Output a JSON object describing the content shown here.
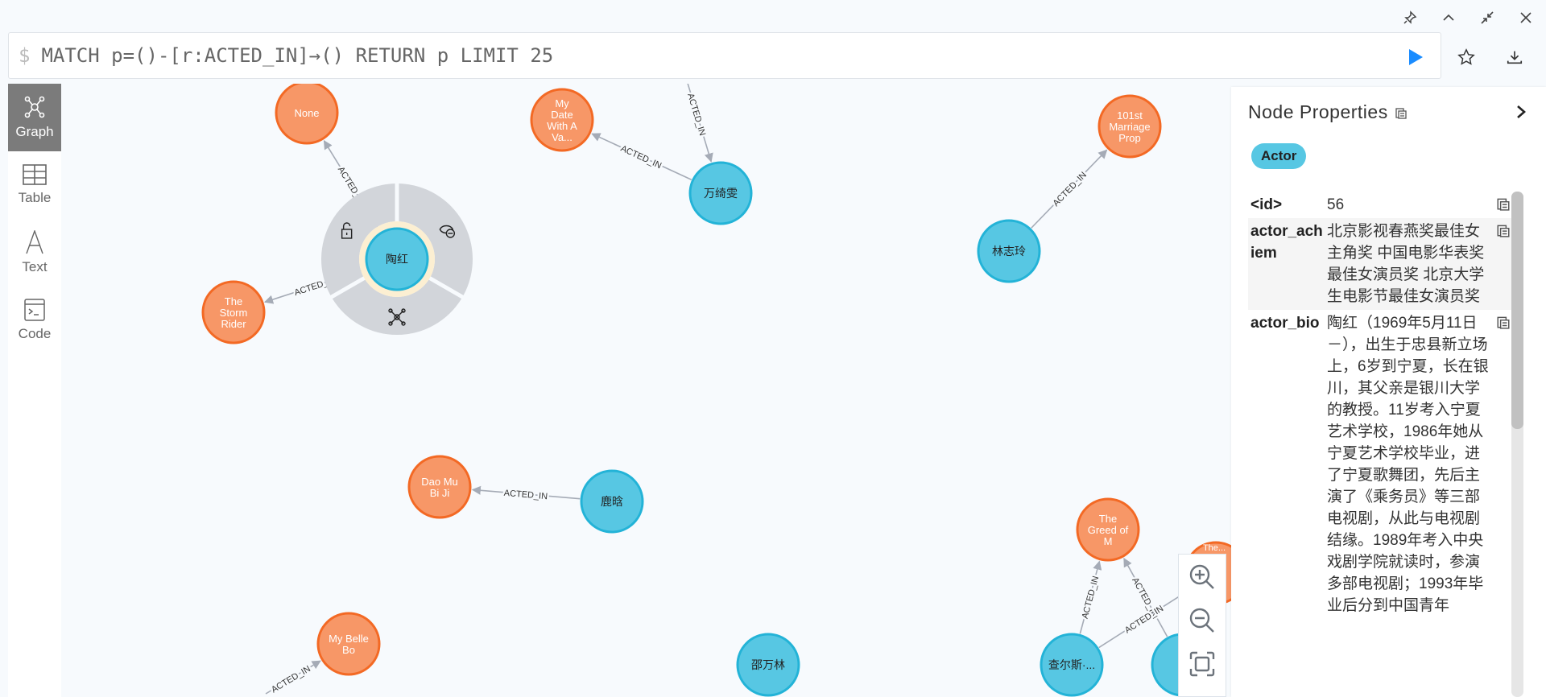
{
  "window_controls": {
    "pin": "pin-icon",
    "collapse": "chevron-up-icon",
    "minimize": "shrink-icon",
    "close": "close-icon"
  },
  "query": {
    "prompt": "$",
    "text": "MATCH p=()-[r:ACTED_IN]→() RETURN p LIMIT 25"
  },
  "sidebar": {
    "items": [
      {
        "label": "Graph",
        "icon": "graph-icon",
        "active": true
      },
      {
        "label": "Table",
        "icon": "table-icon"
      },
      {
        "label": "Text",
        "icon": "text-icon"
      },
      {
        "label": "Code",
        "icon": "code-icon"
      }
    ]
  },
  "colors": {
    "actor": "#57c7e3",
    "actor_border": "#23b3d7",
    "movie": "#f79767",
    "movie_border": "#f36924",
    "edge": "#a5abb6",
    "run": "#1a8cff",
    "ring": "#d2d5da",
    "halo": "#fcefd2"
  },
  "graph": {
    "nodes": [
      {
        "id": "n0",
        "label": "None",
        "type": "Movie"
      },
      {
        "id": "n1",
        "label": "My Date With A Va...",
        "type": "Movie",
        "lines": [
          "My",
          "Date",
          "With A",
          "Va..."
        ]
      },
      {
        "id": "n2",
        "label": "万绮雯",
        "type": "Actor"
      },
      {
        "id": "n3",
        "label": "101st Marriage Prop",
        "type": "Movie",
        "lines": [
          "101st",
          "Marriage",
          "Prop"
        ]
      },
      {
        "id": "n4",
        "label": "林志玲",
        "type": "Actor"
      },
      {
        "id": "n5",
        "label": "陶红",
        "type": "Actor",
        "selected": true
      },
      {
        "id": "n6",
        "label": "The Storm Rider",
        "type": "Movie",
        "lines": [
          "The",
          "Storm",
          "Rider"
        ]
      },
      {
        "id": "n7",
        "label": "Dao Mu Bi Ji",
        "type": "Movie",
        "lines": [
          "Dao Mu",
          "Bi Ji"
        ]
      },
      {
        "id": "n8",
        "label": "鹿晗",
        "type": "Actor"
      },
      {
        "id": "n9",
        "label": "My Belle Bo",
        "type": "Movie",
        "lines": [
          "My Belle",
          "Bo"
        ]
      },
      {
        "id": "n10",
        "label": "邵万林",
        "type": "Actor"
      },
      {
        "id": "n11",
        "label": "The Greed of M",
        "type": "Movie",
        "lines": [
          "The",
          "Greed of",
          "M"
        ]
      },
      {
        "id": "n12",
        "label": "The...",
        "type": "Movie",
        "lines": [
          "Th",
          "e",
          "M"
        ]
      },
      {
        "id": "n13",
        "label": "查尔斯·...",
        "type": "Actor"
      },
      {
        "id": "n14",
        "label": "",
        "type": "Actor"
      }
    ],
    "edges": [
      {
        "from": "n5",
        "to": "n0",
        "label": "ACTED_IN"
      },
      {
        "from": "n5",
        "to": "n6",
        "label": "ACTED_IN"
      },
      {
        "from": "n2",
        "to": "n1",
        "label": "ACTED_IN"
      },
      {
        "from": "top",
        "to": "n2",
        "label": "ACTED_IN"
      },
      {
        "from": "n4",
        "to": "n3",
        "label": "ACTED_IN"
      },
      {
        "from": "n8",
        "to": "n7",
        "label": "ACTED_IN"
      },
      {
        "from": "bottom",
        "to": "n9",
        "label": "ACTED_IN"
      },
      {
        "from": "n13",
        "to": "n11",
        "label": "ACTED_IN"
      },
      {
        "from": "n14",
        "to": "n11",
        "label": "ACTED_IN"
      },
      {
        "from": "n13",
        "to": "n12",
        "label": "ACTED_IN"
      }
    ],
    "ring_actions": [
      "unlock-icon",
      "hide-icon",
      "expand-graph-icon"
    ]
  },
  "zoom_controls": [
    "zoom-in-icon",
    "zoom-out-icon",
    "fit-icon"
  ],
  "panel": {
    "title": "Node Properties",
    "label_badge": "Actor",
    "properties": [
      {
        "key": "<id>",
        "value": "56"
      },
      {
        "key": "actor_achiem",
        "value": "北京影视春燕奖最佳女主角奖 中国电影华表奖最佳女演员奖 北京大学生电影节最佳女演员奖"
      },
      {
        "key": "actor_bio",
        "value": "陶红（1969年5月11日－），出生于忠县新立场上，6岁到宁夏，长在银川，其父亲是银川大学的教授。11岁考入宁夏艺术学校，1986年她从宁夏艺术学校毕业，进了宁夏歌舞团，先后主演了《乘务员》等三部电视剧，从此与电视剧结缘。1989年考入中央戏剧学院就读时，参演多部电视剧；1993年毕业后分到中国青年"
      }
    ],
    "scroll_fraction": 0.47
  }
}
